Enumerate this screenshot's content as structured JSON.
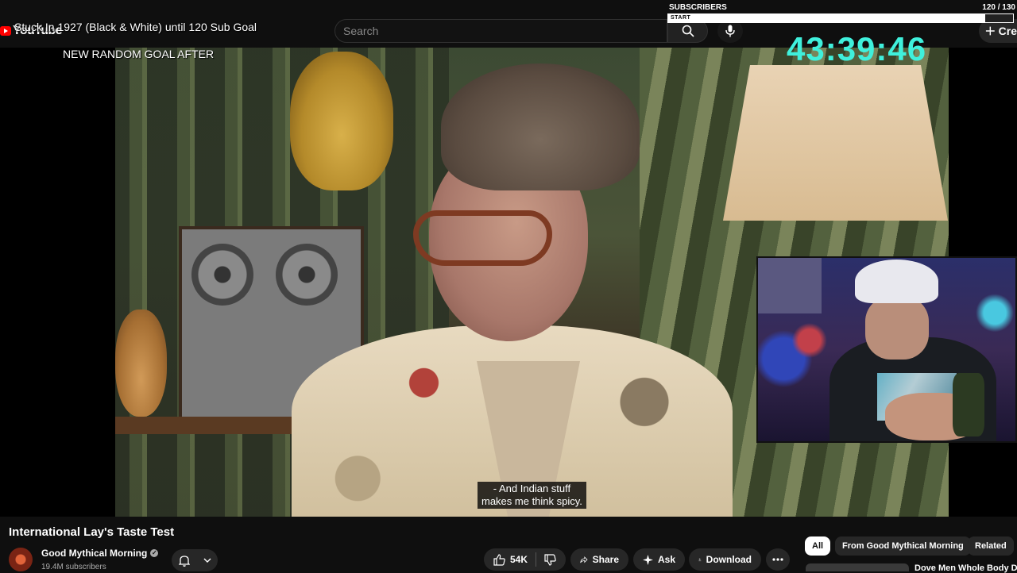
{
  "overlay": {
    "stream_title": "Stuck In 1927 (Black & White) until 120 Sub Goal",
    "goal_text": "NEW RANDOM GOAL AFTER",
    "subscribers_label": "SUBSCRIBERS",
    "subscribers_count": "120  / 130",
    "subscribers_progress": 0.92,
    "progress_start_label": "START",
    "timer": "43:39:46"
  },
  "header": {
    "logo_text": "YouTube",
    "search_placeholder": "Search",
    "create_label": "Cre",
    "icons": [
      "search-icon",
      "mic-icon",
      "plus-icon"
    ]
  },
  "video": {
    "caption_line1": "- And Indian stuff",
    "caption_line2": "makes me think spicy."
  },
  "below": {
    "title": "International Lay's Taste Test",
    "channel": "Good Mythical Morning",
    "subscribers": "19.4M subscribers",
    "likes": "54K",
    "share": "Share",
    "ask": "Ask",
    "download": "Download"
  },
  "chips": {
    "all": "All",
    "channel": "From Good Mythical Morning",
    "related": "Related"
  },
  "recommendation": {
    "title": "Dove Men Whole Body Deo"
  },
  "colors": {
    "background": "#0f0f0f",
    "timer": "#3ff0dc",
    "logo_red": "#ff0000"
  }
}
